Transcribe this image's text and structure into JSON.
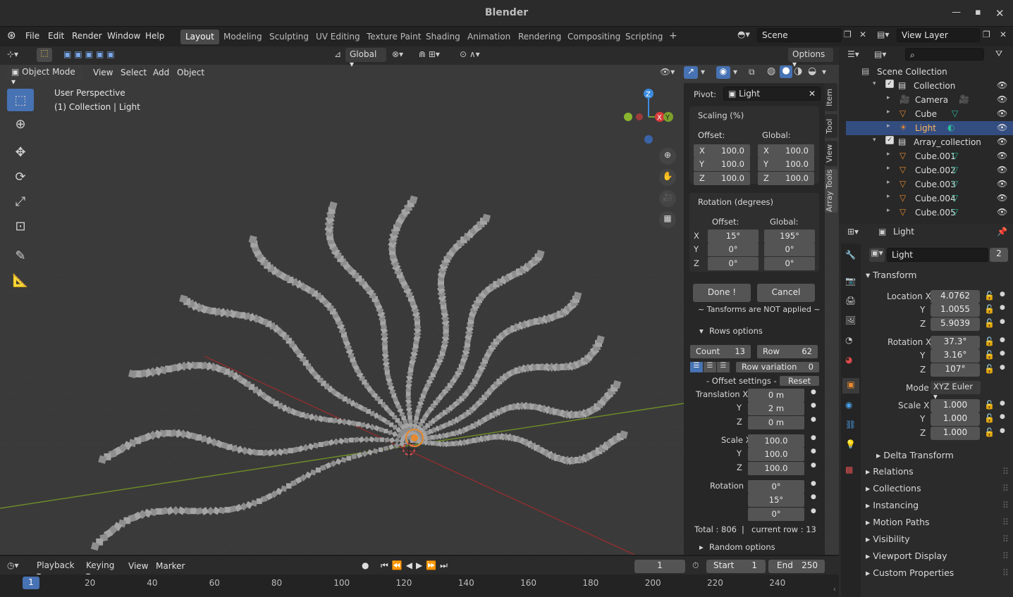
{
  "window": {
    "title": "Blender"
  },
  "menu": [
    "File",
    "Edit",
    "Render",
    "Window",
    "Help"
  ],
  "workspaces": [
    "Layout",
    "Modeling",
    "Sculpting",
    "UV Editing",
    "Texture Paint",
    "Shading",
    "Animation",
    "Rendering",
    "Compositing",
    "Scripting"
  ],
  "topright": {
    "scene": "Scene",
    "view_layer": "View Layer"
  },
  "viewport_header": {
    "orientation": "Global",
    "options": "Options",
    "mode": "Object Mode",
    "menus": [
      "View",
      "Select",
      "Add",
      "Object"
    ]
  },
  "overlay": {
    "perspective": "User Perspective",
    "collection": "(1) Collection | Light"
  },
  "gizmo": {
    "z": "Z",
    "x": "X",
    "y": "Y"
  },
  "side_tabs": [
    "Item",
    "Tool",
    "View",
    "Array Tools"
  ],
  "array_panel": {
    "pivot_label": "Pivot:",
    "pivot_value": "Light",
    "scaling_title": "Scaling (%)",
    "offset_label": "Offset:",
    "global_label": "Global:",
    "scale_offset": [
      {
        "axis": "X",
        "v": "100.0"
      },
      {
        "axis": "Y",
        "v": "100.0"
      },
      {
        "axis": "Z",
        "v": "100.0"
      }
    ],
    "scale_global": [
      {
        "axis": "X",
        "v": "100.0"
      },
      {
        "axis": "Y",
        "v": "100.0"
      },
      {
        "axis": "Z",
        "v": "100.0"
      }
    ],
    "rotation_title": "Rotation (degrees)",
    "rot_axes": [
      "X",
      "Y",
      "Z"
    ],
    "rot_offset": [
      "15°",
      "0°",
      "0°"
    ],
    "rot_global": [
      "195°",
      "0°",
      "0°"
    ],
    "done": "Done !",
    "cancel": "Cancel",
    "notice": "~ Tansforms are NOT applied ~",
    "rows_title": "Rows options",
    "count_label": "Count",
    "count_value": "13",
    "row_label": "Row",
    "row_value": "62",
    "row_variation_label": "Row variation",
    "row_variation_value": "0",
    "offset_settings": "- Offset settings -",
    "reset": "Reset",
    "translation_label": "Translation X",
    "translation": [
      "0 m",
      "2 m",
      "0 m"
    ],
    "scale_label": "Scale X",
    "scale": [
      "100.0",
      "100.0",
      "100.0"
    ],
    "rotation_label": "Rotation",
    "rotation": [
      "0°",
      "15°",
      "0°"
    ],
    "y_label": "Y",
    "z_label": "Z",
    "total": "Total : 806",
    "sep": "|",
    "current_row": "current row : 13",
    "random": "Random options"
  },
  "outliner": {
    "rows": [
      {
        "name": "Scene Collection",
        "indent": 0,
        "type": "scene"
      },
      {
        "name": "Collection",
        "indent": 1,
        "type": "collection"
      },
      {
        "name": "Camera",
        "indent": 2,
        "type": "camera"
      },
      {
        "name": "Cube",
        "indent": 2,
        "type": "mesh"
      },
      {
        "name": "Light",
        "indent": 2,
        "type": "light",
        "selected": true
      },
      {
        "name": "Array_collection",
        "indent": 1,
        "type": "collection"
      },
      {
        "name": "Cube.001",
        "indent": 2,
        "type": "mesh"
      },
      {
        "name": "Cube.002",
        "indent": 2,
        "type": "mesh"
      },
      {
        "name": "Cube.003",
        "indent": 2,
        "type": "mesh"
      },
      {
        "name": "Cube.004",
        "indent": 2,
        "type": "mesh"
      },
      {
        "name": "Cube.005",
        "indent": 2,
        "type": "mesh"
      }
    ]
  },
  "properties": {
    "header_object": "Light",
    "data_name": "Light",
    "users": "2",
    "transform_title": "Transform",
    "location_label": "Location X",
    "location": [
      "4.0762",
      "1.0055",
      "5.9039"
    ],
    "rotation_label": "Rotation X",
    "rotation": [
      "37.3°",
      "3.16°",
      "107°"
    ],
    "mode_label": "Mode",
    "mode": "XYZ Euler",
    "scale_label": "Scale X",
    "scale": [
      "1.000",
      "1.000",
      "1.000"
    ],
    "y_label": "Y",
    "z_label": "Z",
    "delta": "Delta Transform",
    "panels": [
      "Relations",
      "Collections",
      "Instancing",
      "Motion Paths",
      "Visibility",
      "Viewport Display",
      "Custom Properties"
    ]
  },
  "timeline": {
    "menus": [
      "Playback",
      "Keying",
      "View",
      "Marker"
    ],
    "frame": "1",
    "start_label": "Start",
    "start": "1",
    "end_label": "End",
    "end": "250",
    "current": "1",
    "ticks": [
      "20",
      "40",
      "60",
      "80",
      "100",
      "120",
      "140",
      "160",
      "180",
      "200",
      "220",
      "240"
    ]
  },
  "colors": {
    "accent": "#4772b3",
    "mesh": "#2fb89a",
    "object": "#e8892e"
  }
}
